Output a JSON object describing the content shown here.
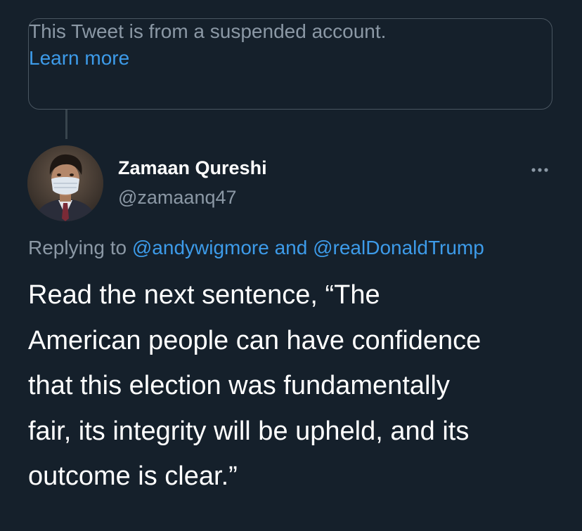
{
  "suspended_notice": {
    "text": "This Tweet is from a suspended account.",
    "link_label": "Learn more"
  },
  "author": {
    "display_name": "Zamaan Qureshi",
    "handle": "@zamaanq47"
  },
  "more_icon": "more-horizontal-icon",
  "reply_context": {
    "prefix": "Replying to",
    "mention_1": "@andywigmore",
    "conjunction": "and",
    "mention_2": "@realDonaldTrump"
  },
  "tweet": {
    "lines": [
      "Read the next sentence, “The",
      "American people can have confidence",
      "that this election was fundamentally",
      "fair, its integrity will be upheld, and its",
      "outcome is clear.”"
    ]
  },
  "colors": {
    "background": "#15202b",
    "link": "#3d9be9",
    "secondary_text": "#8b98a5",
    "primary_text": "#ffffff"
  }
}
